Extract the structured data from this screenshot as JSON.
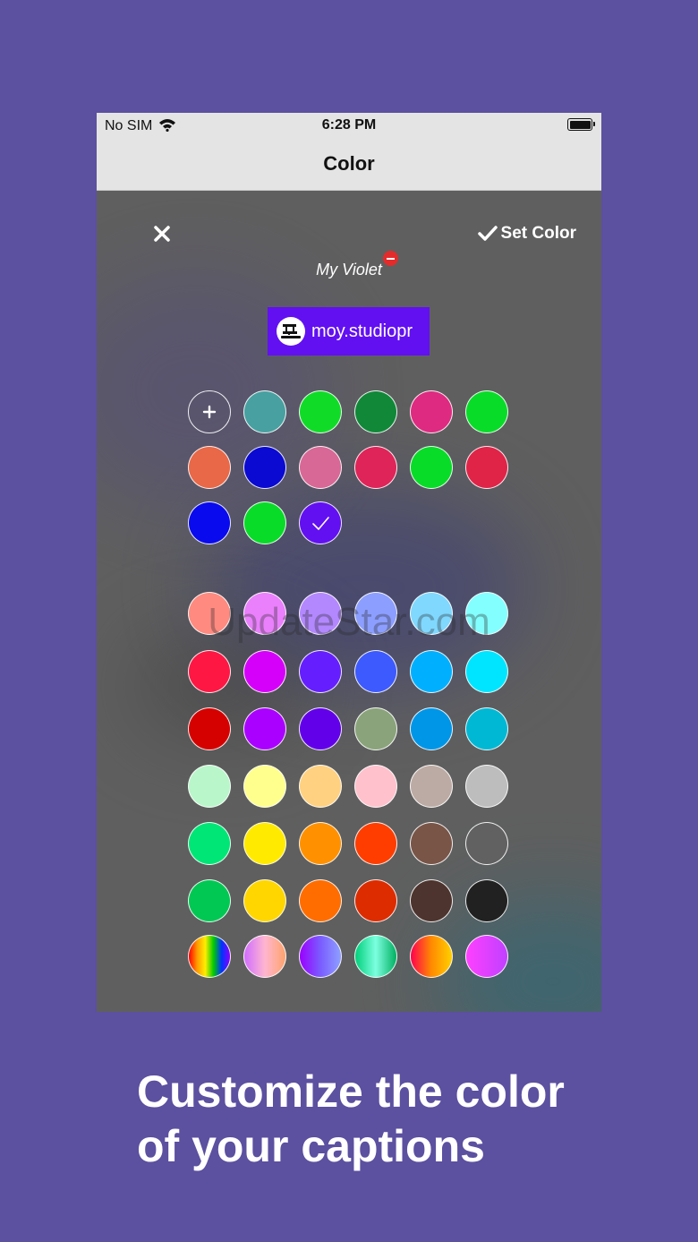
{
  "status_bar": {
    "carrier": "No SIM",
    "time": "6:28 PM"
  },
  "nav": {
    "title": "Color"
  },
  "toolbar": {
    "set_color_label": "Set Color"
  },
  "color_name": "My Violet",
  "preview": {
    "text": "moy.studiopr",
    "background": "#6210f2"
  },
  "saved_colors": {
    "rows": [
      [
        "add",
        "#48a0a0",
        "#10dc28",
        "#108838",
        "#de2a80",
        "#08dc28"
      ],
      [
        "#e86848",
        "#0a0ad2",
        "#d86896",
        "#de2458",
        "#08dc28",
        "#e02448"
      ],
      [
        "#0a0aee",
        "#08dc28",
        "#6210f2"
      ]
    ],
    "selected": "#6210f2"
  },
  "palette": {
    "rows": [
      [
        "#ff8a80",
        "#ea80fc",
        "#b388ff",
        "#8c9eff",
        "#80d8ff",
        "#84ffff"
      ],
      [
        "#ff1744",
        "#d500f9",
        "#651fff",
        "#3d5afe",
        "#00b0ff",
        "#00e5ff"
      ],
      [
        "#d50000",
        "#aa00ff",
        "#6200ea",
        "#8aa37b",
        "#0096e8",
        "#00b8d4"
      ],
      [
        "#b9f6ca",
        "#ffff8d",
        "#ffd180",
        "#ffc1cc",
        "#bcaaa4",
        "#bdbdbd"
      ],
      [
        "#00e676",
        "#ffea00",
        "#ff9100",
        "#ff3d00",
        "#795548",
        "#616161"
      ],
      [
        "#00c853",
        "#ffd600",
        "#ff6d00",
        "#dd2c00",
        "#4e342e",
        "#212121"
      ]
    ],
    "gradients": [
      "linear-gradient(90deg,#ff0000,#ff9900,#ffee00,#00cc00,#0033ff,#8800ff)",
      "linear-gradient(90deg,#d06cff,#ffb6d0,#ffa36c)",
      "linear-gradient(90deg,#9b00ff,#7a5cff,#8ea0ff)",
      "linear-gradient(90deg,#00d07a,#7dffe0,#00b060)",
      "linear-gradient(90deg,#ff0050,#ff8a00,#ffd000)",
      "linear-gradient(90deg,#ff40ff,#c040ff)"
    ]
  },
  "watermark": "UpdateStar.com",
  "caption": "Customize the color\nof your captions"
}
